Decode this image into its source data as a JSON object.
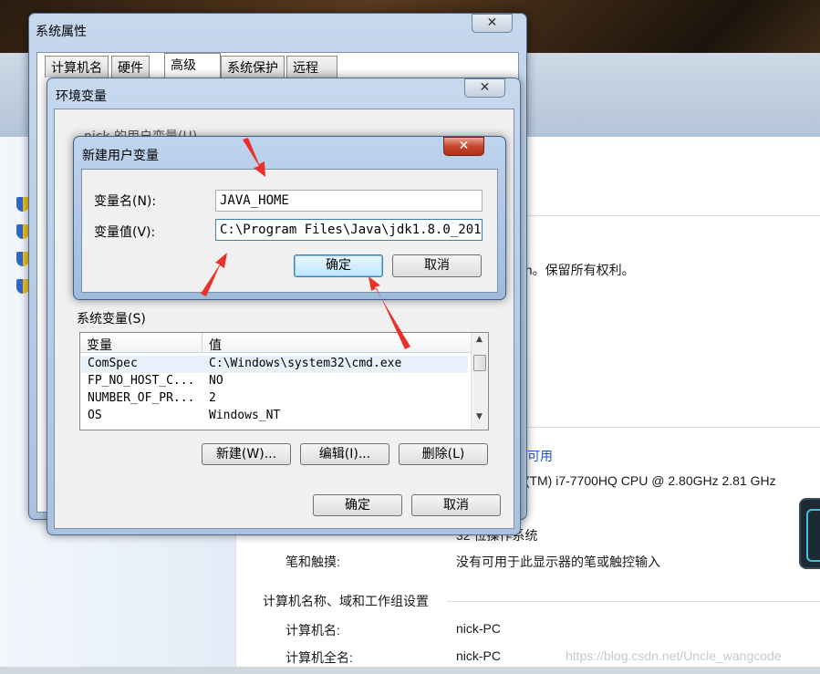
{
  "background": {
    "copyright_fragment": "on。保留所有权利。",
    "link_fragment": "可用",
    "cpu_fragment": "e(TM) i7-7700HQ CPU @ 2.80GHz   2.81 GHz",
    "system_type_value": "32 位操作系统",
    "pen_touch_label": "笔和触摸:",
    "pen_touch_value": "没有可用于此显示器的笔或触控输入",
    "section_heading": "计算机名称、域和工作组设置",
    "computer_name_label": "计算机名:",
    "computer_name_value": "nick-PC",
    "full_name_label": "计算机全名:",
    "full_name_value": "nick-PC",
    "watermark": "https://blog.csdn.net/Uncle_wangcode"
  },
  "system_properties": {
    "title": "系统属性",
    "close_glyph": "✕",
    "tabs": [
      "计算机名",
      "硬件",
      "高级",
      "系统保护",
      "远程"
    ],
    "active_tab": 2
  },
  "env_vars": {
    "title": "环境变量",
    "close_glyph": "✕",
    "user_vars_label": "nick 的用户变量(U)",
    "system_vars_label": "系统变量(S)",
    "columns": [
      "变量",
      "值"
    ],
    "rows": [
      {
        "name": "ComSpec",
        "value": "C:\\Windows\\system32\\cmd.exe"
      },
      {
        "name": "FP_NO_HOST_C...",
        "value": "NO"
      },
      {
        "name": "NUMBER_OF_PR...",
        "value": "2"
      },
      {
        "name": "OS",
        "value": "Windows_NT"
      }
    ],
    "new_button": "新建(W)...",
    "edit_button": "编辑(I)...",
    "delete_button": "删除(L)",
    "ok_button": "确定",
    "cancel_button": "取消"
  },
  "new_user_var": {
    "title": "新建用户变量",
    "close_glyph": "✕",
    "name_label": "变量名(N):",
    "name_value": "JAVA_HOME",
    "value_label": "变量值(V):",
    "value_value": "C:\\Program Files\\Java\\jdk1.8.0_201",
    "ok_button": "确定",
    "cancel_button": "取消"
  },
  "colors": {
    "annotation_red": "#e8312a",
    "title_glass": "#b4c9e3",
    "default_button": "#bee6fd"
  }
}
